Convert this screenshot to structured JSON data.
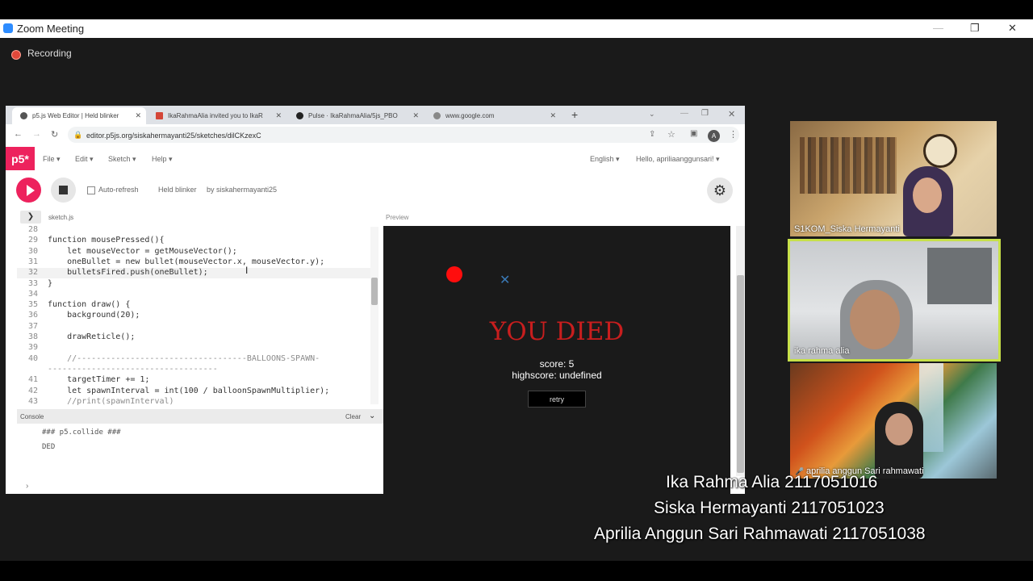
{
  "zoom": {
    "title": "Zoom Meeting",
    "recording_label": "Recording",
    "minimize_icon": "—",
    "restore_icon": "❐",
    "close_icon": "✕"
  },
  "browser": {
    "tabs": [
      {
        "title": "p5.js Web Editor | Held blinker",
        "active": true
      },
      {
        "title": "IkaRahmaAlia invited you to IkaR",
        "active": false
      },
      {
        "title": "Pulse · IkaRahmaAlia/5js_PBO",
        "active": false
      },
      {
        "title": "www.google.com",
        "active": false
      }
    ],
    "url": "editor.p5js.org/siskahermayanti25/sketches/dilCKzexC",
    "profile_initial": "A"
  },
  "p5": {
    "logo": "p5*",
    "menus": [
      "File ▾",
      "Edit ▾",
      "Sketch ▾",
      "Help ▾"
    ],
    "language": "English ▾",
    "user": "Hello, apriliaanggunsari! ▾",
    "auto_refresh_label": "Auto-refresh",
    "sketch_name": "Held blinker",
    "sketch_by": "by siskahermayanti25",
    "file_name": "sketch.js",
    "preview_label": "Preview",
    "console_label": "Console",
    "console_clear": "Clear",
    "console_lines": [
      "### p5.collide ###",
      "DED"
    ],
    "console_prompt": "›"
  },
  "code_lines": [
    {
      "n": "28",
      "t": ""
    },
    {
      "n": "29",
      "t": "function mousePressed(){"
    },
    {
      "n": "30",
      "t": "    let mouseVector = getMouseVector();"
    },
    {
      "n": "31",
      "t": "    oneBullet = new bullet(mouseVector.x, mouseVector.y);"
    },
    {
      "n": "32",
      "t": "    bulletsFired.push(oneBullet);"
    },
    {
      "n": "33",
      "t": "}"
    },
    {
      "n": "34",
      "t": ""
    },
    {
      "n": "35",
      "t": "function draw() {"
    },
    {
      "n": "36",
      "t": "    background(20);"
    },
    {
      "n": "37",
      "t": ""
    },
    {
      "n": "38",
      "t": "    drawReticle();"
    },
    {
      "n": "39",
      "t": ""
    },
    {
      "n": "40",
      "t": "    //-----------------------------------BALLOONS-SPAWN-"
    },
    {
      "n": "",
      "t": "-----------------------------------"
    },
    {
      "n": "41",
      "t": "    targetTimer += 1;"
    },
    {
      "n": "42",
      "t": "    let spawnInterval = int(100 / balloonSpawnMultiplier);"
    },
    {
      "n": "43",
      "t": "    //print(spawnInterval)"
    }
  ],
  "game": {
    "title": "YOU DIED",
    "score": "score: 5",
    "highscore": "highscore: undefined",
    "retry": "retry"
  },
  "participants": [
    {
      "name": "S1KOM_Siska Hermayanti"
    },
    {
      "name": "ika rahma alia"
    },
    {
      "name": "aprilia anggun Sari rahmawati"
    }
  ],
  "captions": [
    "Ika Rahma Alia 2117051016",
    "Siska Hermayanti 2117051023",
    "Aprilia Anggun Sari Rahmawati 2117051038"
  ],
  "colors": {
    "p5_pink": "#ed225d",
    "active_speaker": "#c7e04a",
    "you_died": "#c81e1e"
  }
}
